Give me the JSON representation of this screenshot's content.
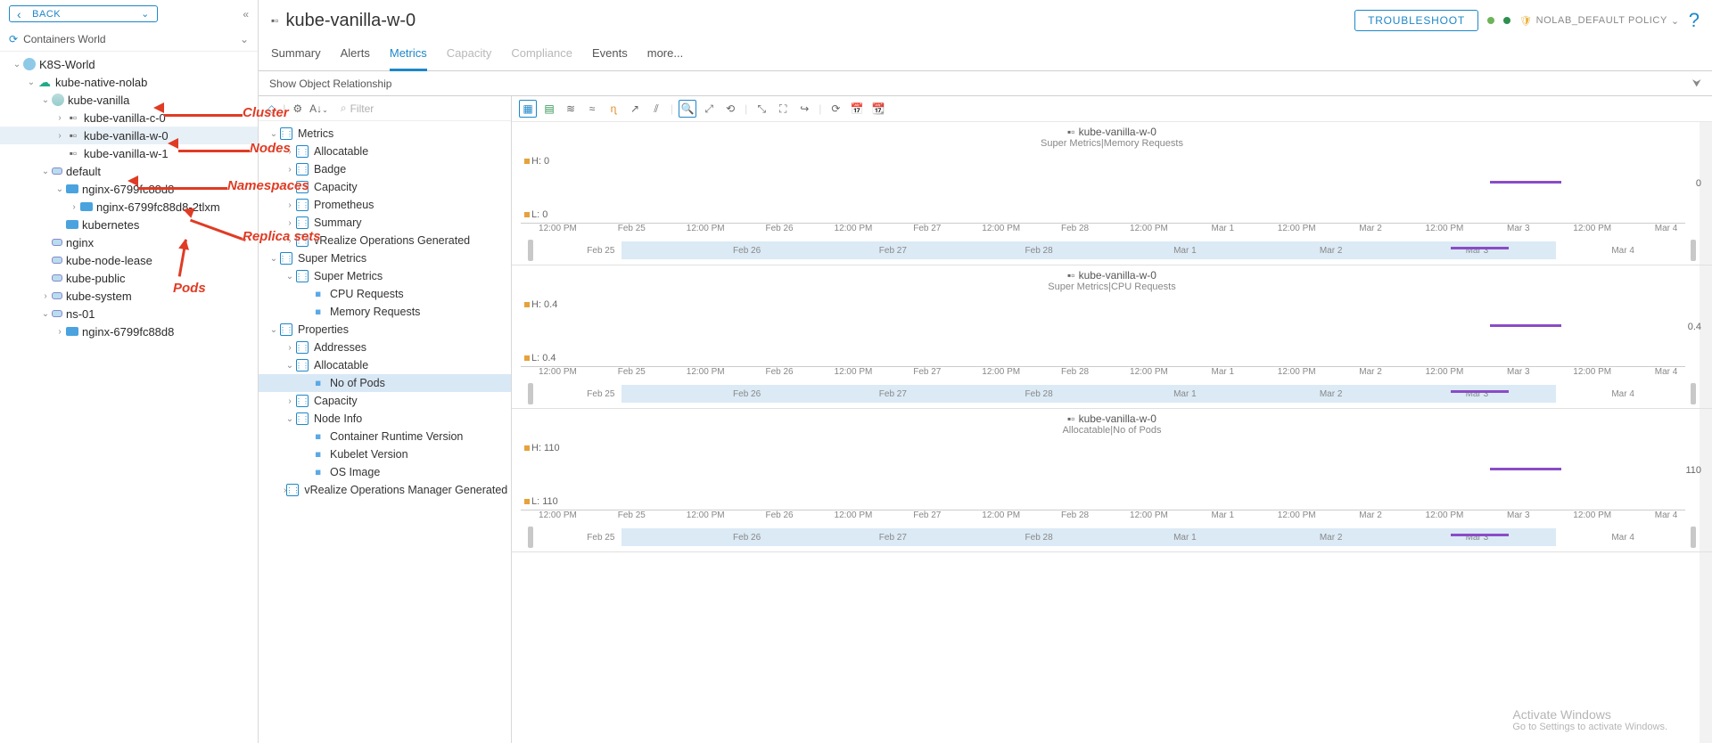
{
  "sidebar": {
    "back": "BACK",
    "scope": "Containers World",
    "tree": [
      {
        "d": 0,
        "exp": "v",
        "icon": "world",
        "label": "K8S-World"
      },
      {
        "d": 1,
        "exp": "v",
        "icon": "cloud",
        "label": "kube-native-nolab"
      },
      {
        "d": 2,
        "exp": "v",
        "icon": "cluster",
        "label": "kube-vanilla"
      },
      {
        "d": 3,
        "exp": ">",
        "icon": "node",
        "label": "kube-vanilla-c-0"
      },
      {
        "d": 3,
        "exp": ">",
        "icon": "node",
        "label": "kube-vanilla-w-0",
        "sel": true
      },
      {
        "d": 3,
        "exp": "",
        "icon": "node",
        "label": "kube-vanilla-w-1"
      },
      {
        "d": 2,
        "exp": "v",
        "icon": "ns",
        "label": "default"
      },
      {
        "d": 3,
        "exp": "v",
        "icon": "rs",
        "label": "nginx-6799fc88d8"
      },
      {
        "d": 4,
        "exp": ">",
        "icon": "pod",
        "label": "nginx-6799fc88d8-2tlxm"
      },
      {
        "d": 3,
        "exp": "",
        "icon": "rs",
        "label": "kubernetes"
      },
      {
        "d": 2,
        "exp": "",
        "icon": "ns",
        "label": "nginx"
      },
      {
        "d": 2,
        "exp": "",
        "icon": "ns",
        "label": "kube-node-lease"
      },
      {
        "d": 2,
        "exp": "",
        "icon": "ns",
        "label": "kube-public"
      },
      {
        "d": 2,
        "exp": ">",
        "icon": "ns",
        "label": "kube-system"
      },
      {
        "d": 2,
        "exp": "v",
        "icon": "ns",
        "label": "ns-01"
      },
      {
        "d": 3,
        "exp": ">",
        "icon": "rs",
        "label": "nginx-6799fc88d8"
      }
    ]
  },
  "header": {
    "title": "kube-vanilla-w-0",
    "troubleshoot": "TROUBLESHOOT",
    "policy_label": "NOLAB_DEFAULT POLICY"
  },
  "tabs": [
    {
      "label": "Summary"
    },
    {
      "label": "Alerts"
    },
    {
      "label": "Metrics",
      "active": true
    },
    {
      "label": "Capacity",
      "disabled": true
    },
    {
      "label": "Compliance",
      "disabled": true
    },
    {
      "label": "Events"
    },
    {
      "label": "more..."
    }
  ],
  "relationship_bar": "Show Object Relationship",
  "filter_placeholder": "Filter",
  "metrics_tree": [
    {
      "d": 0,
      "exp": "v",
      "t": "grp",
      "label": "Metrics"
    },
    {
      "d": 1,
      "exp": ">",
      "t": "grp",
      "label": "Allocatable"
    },
    {
      "d": 1,
      "exp": ">",
      "t": "grp",
      "label": "Badge"
    },
    {
      "d": 1,
      "exp": ">",
      "t": "grp",
      "label": "Capacity"
    },
    {
      "d": 1,
      "exp": ">",
      "t": "grp",
      "label": "Prometheus"
    },
    {
      "d": 1,
      "exp": ">",
      "t": "grp",
      "label": "Summary"
    },
    {
      "d": 1,
      "exp": ">",
      "t": "grp",
      "label": "vRealize Operations Generated"
    },
    {
      "d": 0,
      "exp": "v",
      "t": "grp",
      "label": "Super Metrics"
    },
    {
      "d": 1,
      "exp": "v",
      "t": "grp",
      "label": "Super Metrics"
    },
    {
      "d": 2,
      "exp": "",
      "t": "leaf",
      "label": "CPU Requests"
    },
    {
      "d": 2,
      "exp": "",
      "t": "leaf",
      "label": "Memory Requests"
    },
    {
      "d": 0,
      "exp": "v",
      "t": "grp",
      "label": "Properties"
    },
    {
      "d": 1,
      "exp": ">",
      "t": "grp",
      "label": "Addresses"
    },
    {
      "d": 1,
      "exp": "v",
      "t": "grp",
      "label": "Allocatable"
    },
    {
      "d": 2,
      "exp": "",
      "t": "leaf",
      "label": "No of Pods",
      "sel": true
    },
    {
      "d": 1,
      "exp": ">",
      "t": "grp",
      "label": "Capacity"
    },
    {
      "d": 1,
      "exp": "v",
      "t": "grp",
      "label": "Node Info"
    },
    {
      "d": 2,
      "exp": "",
      "t": "leaf",
      "label": "Container Runtime Version"
    },
    {
      "d": 2,
      "exp": "",
      "t": "leaf",
      "label": "Kubelet Version"
    },
    {
      "d": 2,
      "exp": "",
      "t": "leaf",
      "label": "OS Image"
    },
    {
      "d": 1,
      "exp": ">",
      "t": "grp",
      "label": "vRealize Operations Manager Generated ..."
    }
  ],
  "chart_toolbar_icons": [
    "grid-icon",
    "stack-icon",
    "line-icon",
    "trend-icon",
    "anomaly-icon",
    "compare-icon",
    "split-icon",
    "zoom-icon",
    "pan-icon",
    "reset-icon",
    "fit-icon",
    "maximize-icon",
    "share-icon",
    "refresh-icon",
    "date-icon",
    "range-icon"
  ],
  "axis_ticks_main": [
    "12:00 PM",
    "Feb 25",
    "12:00 PM",
    "Feb 26",
    "12:00 PM",
    "Feb 27",
    "12:00 PM",
    "Feb 28",
    "12:00 PM",
    "Mar 1",
    "12:00 PM",
    "Mar 2",
    "12:00 PM",
    "Mar 3",
    "12:00 PM",
    "Mar 4"
  ],
  "axis_ticks_overview": [
    "Feb 25",
    "Feb 26",
    "Feb 27",
    "Feb 28",
    "Mar 1",
    "Mar 2",
    "Mar 3",
    "Mar 4"
  ],
  "chart_data": [
    {
      "type": "line",
      "title": "kube-vanilla-w-0",
      "subtitle": "Super Metrics|Memory Requests",
      "high_label": "H: 0",
      "low_label": "L: 0",
      "right_label": "0",
      "series": [
        {
          "name": "Memory Requests",
          "segment": {
            "from": "Mar 3 02:00",
            "to": "Mar 3 10:00",
            "value": 0
          }
        }
      ]
    },
    {
      "type": "line",
      "title": "kube-vanilla-w-0",
      "subtitle": "Super Metrics|CPU Requests",
      "high_label": "H: 0.4",
      "low_label": "L: 0.4",
      "right_label": "0.4",
      "series": [
        {
          "name": "CPU Requests",
          "segment": {
            "from": "Mar 3 02:00",
            "to": "Mar 3 10:00",
            "value": 0.4
          }
        }
      ]
    },
    {
      "type": "line",
      "title": "kube-vanilla-w-0",
      "subtitle": "Allocatable|No of Pods",
      "high_label": "H: 110",
      "low_label": "L: 110",
      "right_label": "110",
      "series": [
        {
          "name": "No of Pods",
          "segment": {
            "from": "Mar 3 02:00",
            "to": "Mar 3 10:00",
            "value": 110
          }
        }
      ]
    }
  ],
  "annotations": {
    "cluster": "Cluster",
    "nodes": "Nodes",
    "namespaces": "Namespaces",
    "replica": "Replica sets",
    "pods": "Pods"
  },
  "watermark": {
    "l1": "Activate Windows",
    "l2": "Go to Settings to activate Windows."
  }
}
